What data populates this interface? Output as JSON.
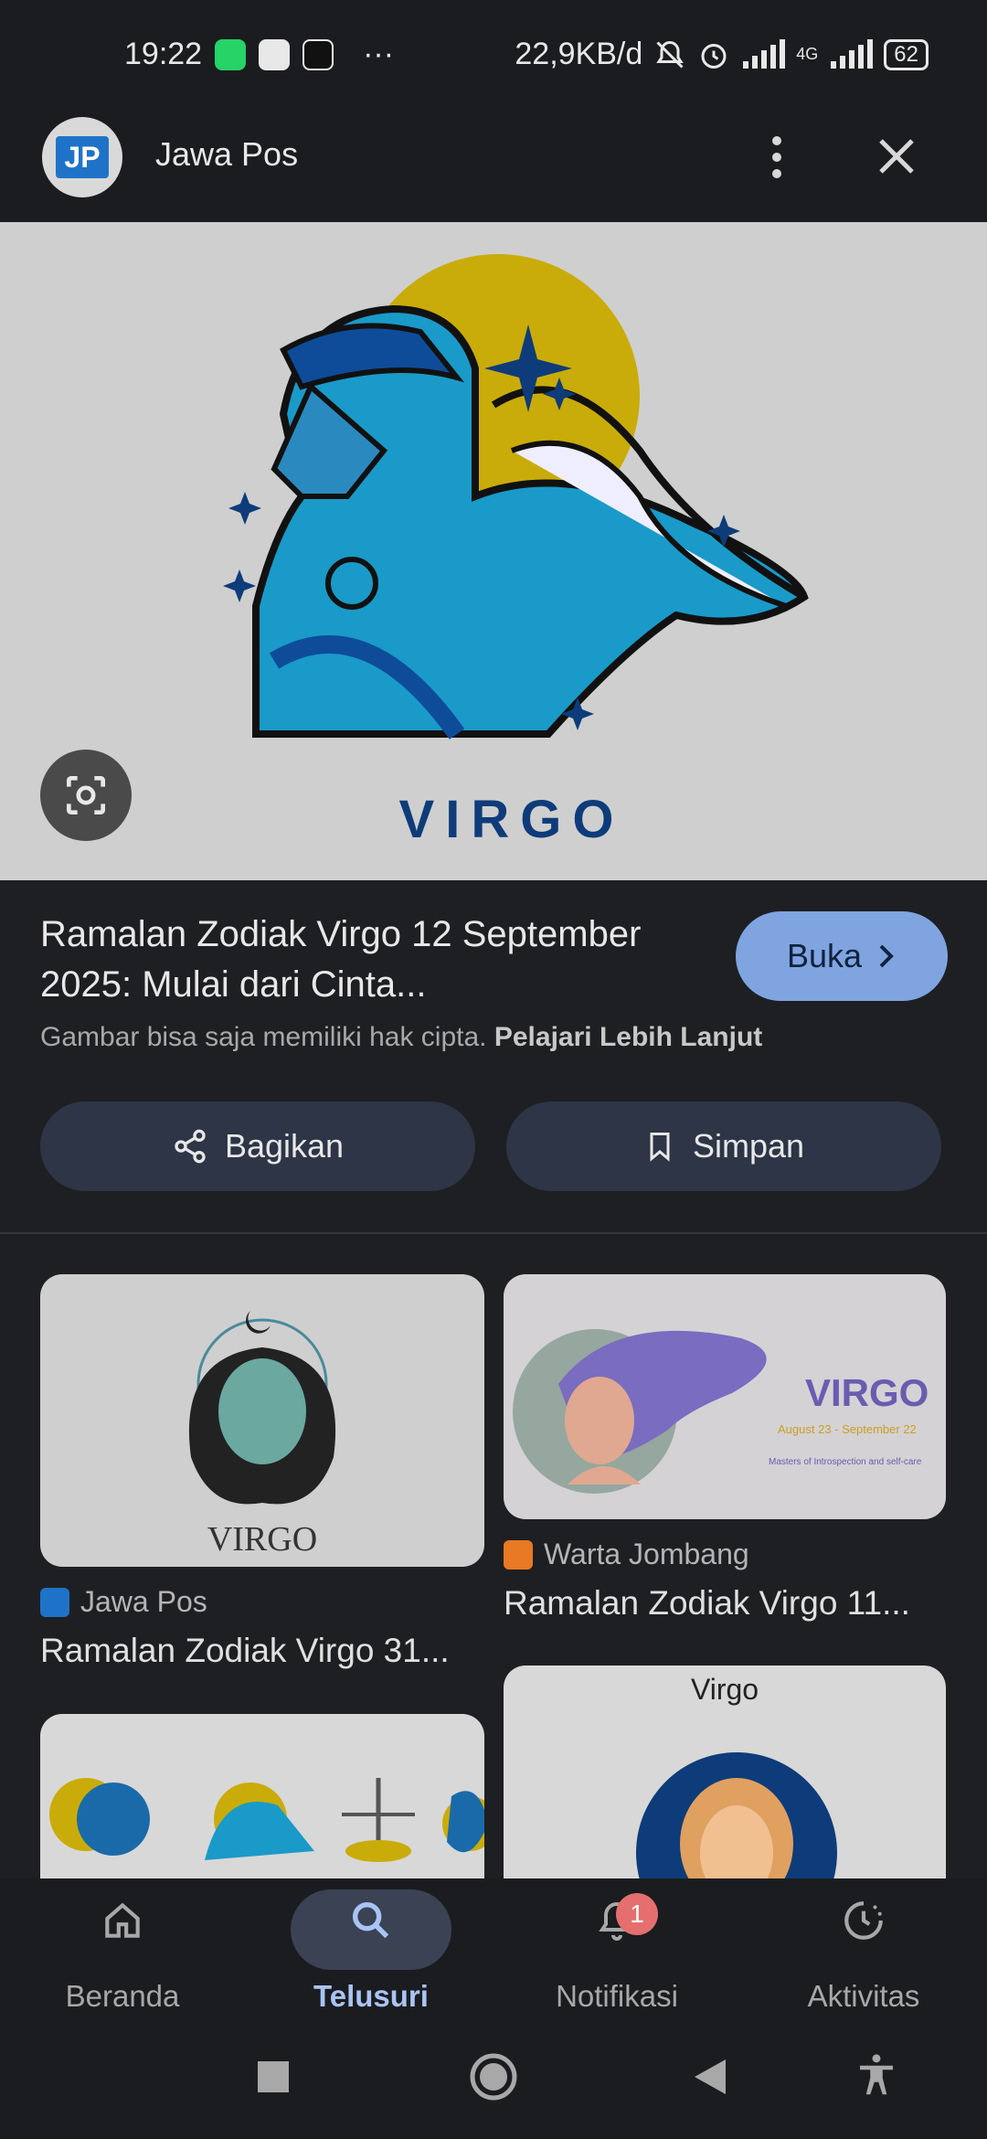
{
  "status_bar": {
    "time": "19:22",
    "more": "···",
    "speed": "22,9KB/d",
    "network": "4G",
    "battery": "62"
  },
  "header": {
    "logo_text": "JP",
    "site_name": "Jawa Pos"
  },
  "hero": {
    "caption": "VIRGO"
  },
  "result": {
    "title": "Ramalan Zodiak Virgo 12 September 2025: Mulai dari Cinta...",
    "open_label": "Buka",
    "copyright_text": "Gambar bisa saja memiliki hak cipta.",
    "learn_more": "Pelajari Lebih Lanjut"
  },
  "actions": {
    "share_label": "Bagikan",
    "save_label": "Simpan"
  },
  "related": [
    {
      "source": "Jawa Pos",
      "title": "Ramalan Zodiak Virgo 31...",
      "image_text": "VIRGO"
    },
    {
      "source": "Warta Jombang",
      "title": "Ramalan Zodiak Virgo 11...",
      "image_text": "VIRGO",
      "image_subtext": "August 23 - September 22",
      "image_tagline": "Masters of Introspection and self-care"
    },
    {
      "image_text": ""
    },
    {
      "image_text": "Virgo"
    }
  ],
  "bottom_nav": [
    {
      "label": "Beranda",
      "icon": "home-icon"
    },
    {
      "label": "Telusuri",
      "icon": "search-icon",
      "active": true
    },
    {
      "label": "Notifikasi",
      "icon": "bell-icon",
      "badge": "1"
    },
    {
      "label": "Aktivitas",
      "icon": "activity-icon"
    }
  ],
  "colors": {
    "background": "#1e1f22",
    "accent": "#7fa4e0",
    "active_label": "#a9c4f5",
    "pill": "#2d3546"
  }
}
